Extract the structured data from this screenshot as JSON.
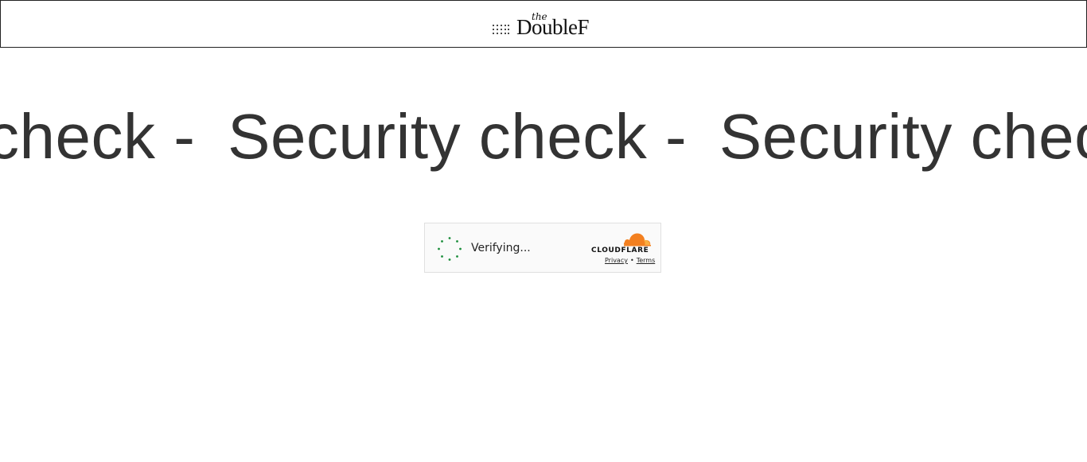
{
  "header": {
    "logo_small": "the",
    "logo_main": "DoubleF"
  },
  "marquee": {
    "text": "Security check - "
  },
  "turnstile": {
    "status": "Verifying...",
    "brand": "CLOUDFLARE",
    "privacy_label": "Privacy",
    "separator": "•",
    "terms_label": "Terms"
  },
  "colors": {
    "heading": "#333333",
    "spinner": "#1a8d3a",
    "cloudflare_orange": "#f38020",
    "cloudflare_light": "#faae40"
  },
  "icons": {
    "logo_mark": "dot-grid-icon",
    "spinner": "loading-spinner-icon",
    "cloud": "cloudflare-cloud-icon"
  }
}
